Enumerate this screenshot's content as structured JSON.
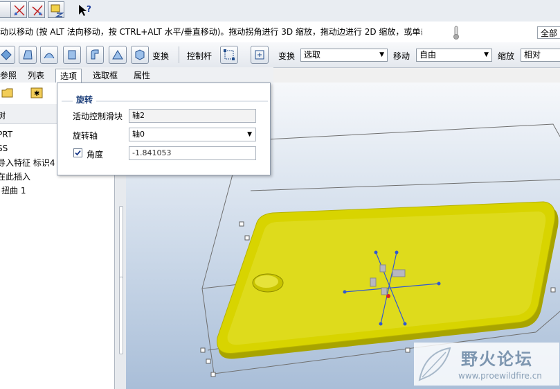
{
  "message": {
    "text": "动以移动 (按 ALT 法向移动，按 CTRL+ALT 水平/垂直移动)。拖动拐角进行 3D 缩放，拖动边进行 2D 缩放，或单击边并拖动",
    "filter_value": "全部"
  },
  "dashboard": {
    "transform_label": "变换",
    "handle_label": "控制杆",
    "transform2_label": "变换",
    "transform_select": "选取",
    "move_label": "移动",
    "move_select": "自由",
    "scale_label": "缩放",
    "scale_select": "相对"
  },
  "tabs": [
    {
      "label": "参照"
    },
    {
      "label": "列表"
    },
    {
      "label": "选项"
    },
    {
      "label": "选取框"
    },
    {
      "label": "属性"
    }
  ],
  "tree": {
    "header": "树",
    "items": [
      {
        "label": "PRT"
      },
      {
        "label": "SS"
      },
      {
        "label": "导入特征 标识4"
      },
      {
        "label": "在此插入"
      },
      {
        "label": "扭曲 1"
      }
    ]
  },
  "popup": {
    "section_title": "旋转",
    "active_slider_label": "活动控制滑块",
    "active_slider_value": "轴2",
    "rotate_axis_label": "旋转轴",
    "rotate_axis_value": "轴0",
    "angle_label": "角度",
    "angle_checked": true,
    "angle_value": "-1.841053"
  },
  "watermark": {
    "title": "野火论坛",
    "url": "www.proewildfire.cn"
  },
  "colors": {
    "part_yellow": "#d8d400",
    "axis_blue": "#3158d0",
    "title_blue": "#1d3f7a"
  }
}
